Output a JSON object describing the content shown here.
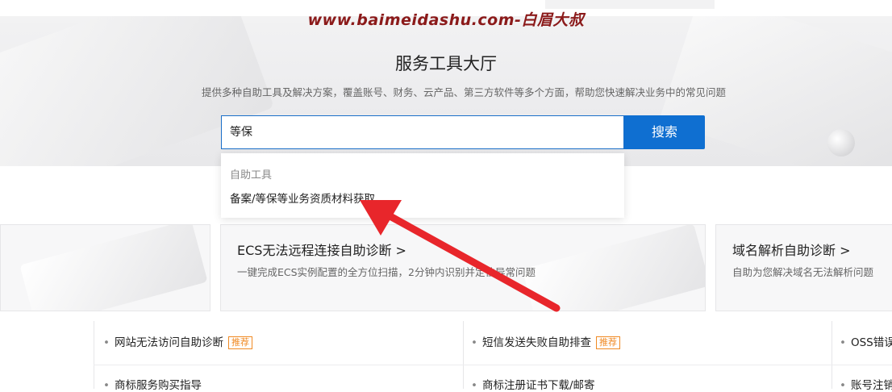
{
  "watermark": "www.baimeidashu.com-白眉大叔",
  "hero": {
    "title": "服务工具大厅",
    "subtitle": "提供多种自助工具及解决方案，覆盖账号、财务、云产品、第三方软件等多个方面，帮助您快速解决业务中的常见问题"
  },
  "search": {
    "value": "等保",
    "button_label": "搜索"
  },
  "dropdown": {
    "group_label": "自助工具",
    "items": [
      "备案/等保等业务资质材料获取"
    ]
  },
  "cards": [
    {
      "title": "ECS无法远程连接自助诊断 >",
      "desc": "一键完成ECS实例配置的全方位扫描，2分钟内识别并定位异常问题"
    },
    {
      "title": "域名解析自助诊断 >",
      "desc": "自助为您解决域名无法解析问题"
    }
  ],
  "list": {
    "col1": [
      {
        "label": "网站无法访问自助诊断",
        "badge": "推荐"
      },
      {
        "label": "商标服务购买指导",
        "badge": ""
      }
    ],
    "col2": [
      {
        "label": "短信发送失败自助排查",
        "badge": "推荐"
      },
      {
        "label": "商标注册证书下载/邮寄",
        "badge": ""
      }
    ],
    "col3": [
      {
        "label": "OSS错误",
        "badge": ""
      },
      {
        "label": "账号注销",
        "badge": ""
      }
    ]
  },
  "colors": {
    "accent": "#0f6fd1",
    "badge": "#f08a24",
    "annotation_arrow": "#e8262b",
    "watermark": "#8b1a1a"
  }
}
